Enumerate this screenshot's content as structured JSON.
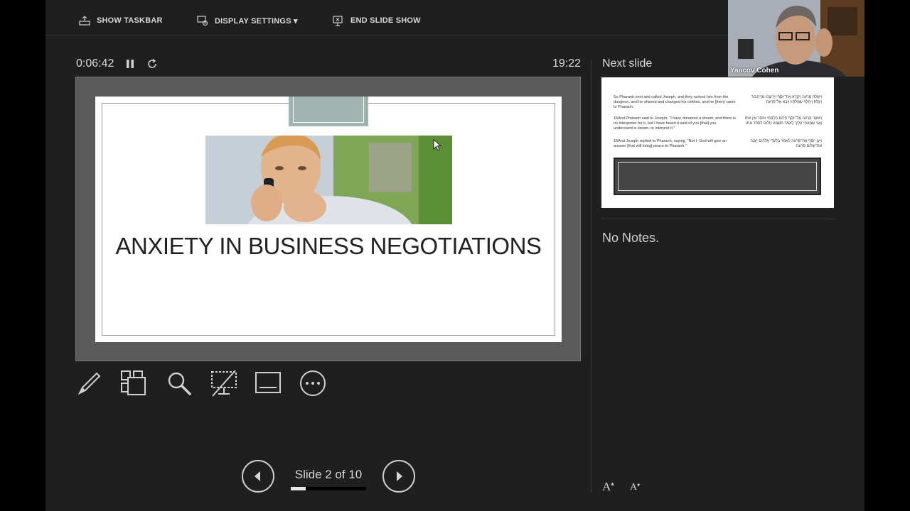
{
  "toolbar": {
    "show_taskbar": "SHOW TASKBAR",
    "display_settings": "DISPLAY SETTINGS ▾",
    "end_slide_show": "END SLIDE SHOW"
  },
  "timer": {
    "elapsed": "0:06:42",
    "clock": "19:22"
  },
  "current_slide": {
    "title": "ANXIETY IN BUSINESS NEGOTIATIONS"
  },
  "navigation": {
    "slide_label": "Slide 2 of 10",
    "progress": 0.2
  },
  "next_slide": {
    "label": "Next slide",
    "english_1": "So Pharaoh sent and called Joseph, and they rushed him from the dungeon, and he shaved and changed his clothes, and he [then] came to Pharaoh.",
    "english_2": "15And Pharaoh said to Joseph, \"I have dreamed a dream, and there is no interpreter for it, but I have heard it said of you [that] you understand a dream, to interpret it.\"",
    "english_3": "16And Joseph replied to Pharaoh, saying, \"Not I; God will give an answer [that will bring] peace to Pharaoh.\"",
    "hebrew_1": "וַיִּשְׁלַח פַּרְעֹה וַיִּקְרָא אֶת־יוֹסֵף וַיְרִיצֻהוּ מִן־הַבּוֹר וַיְגַלַּח וַיְחַלֵּף שִׂמְלֹתָיו וַיָּבֹא אֶל־פַּרְעֹה׃",
    "hebrew_2": "וַיֹּאמֶר פַּרְעֹה אֶל־יוֹסֵף חֲלוֹם חָלַמְתִּי וּפֹתֵר אֵין אֹתוֹ וַאֲנִי שָׁמַעְתִּי עָלֶיךָ לֵאמֹר תִּשְׁמַע חֲלוֹם לִפְתֹּר אֹתוֹ׃",
    "hebrew_3": "וַיַּעַן יוֹסֵף אֶת־פַּרְעֹה לֵאמֹר בִּלְעָדָי אֱלֹהִים יַעֲנֶה אֶת־שְׁלוֹם פַּרְעֹה׃"
  },
  "notes": {
    "text": "No Notes."
  },
  "font_controls": {
    "increase": "A",
    "decrease": "A"
  },
  "webcam": {
    "name": "Yaacov Cohen"
  }
}
